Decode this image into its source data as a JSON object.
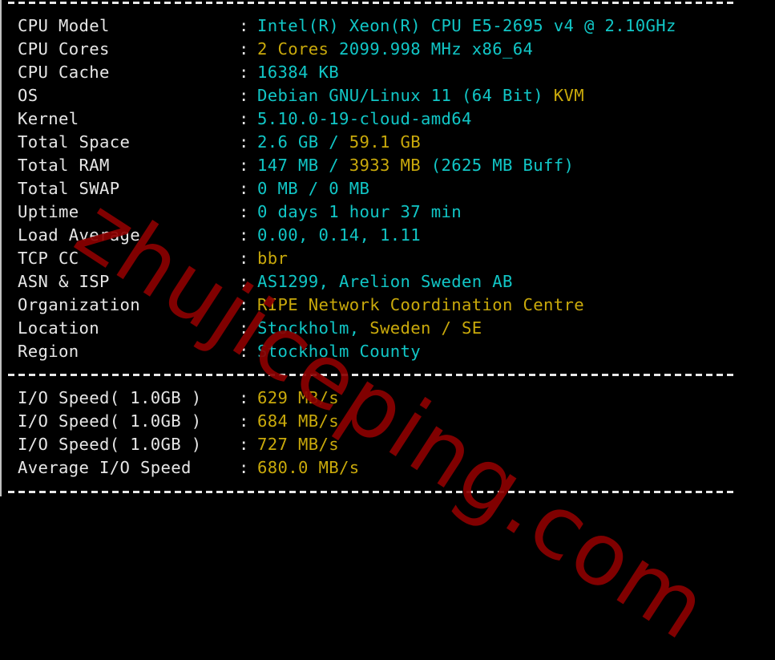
{
  "colors": {
    "background": "#000000",
    "label": "#e6e6e6",
    "cyan": "#11c6c6",
    "yellow": "#c9a90b",
    "watermark": "#8b0000"
  },
  "separator": ":",
  "system_info": [
    {
      "label": "CPU Model",
      "parts": [
        {
          "text": "Intel(R) Xeon(R) CPU E5-2695 v4 @ 2.10GHz",
          "color": "cyan"
        }
      ]
    },
    {
      "label": "CPU Cores",
      "parts": [
        {
          "text": "2 Cores",
          "color": "yellow"
        },
        {
          "text": " 2099.998 MHz x86_64",
          "color": "cyan"
        }
      ]
    },
    {
      "label": "CPU Cache",
      "parts": [
        {
          "text": "16384 KB",
          "color": "cyan"
        }
      ]
    },
    {
      "label": "OS",
      "parts": [
        {
          "text": "Debian GNU/Linux 11 (64 Bit)",
          "color": "cyan"
        },
        {
          "text": " KVM",
          "color": "yellow"
        }
      ]
    },
    {
      "label": "Kernel",
      "parts": [
        {
          "text": "5.10.0-19-cloud-amd64",
          "color": "cyan"
        }
      ]
    },
    {
      "label": "Total Space",
      "parts": [
        {
          "text": "2.6 GB / ",
          "color": "cyan"
        },
        {
          "text": "59.1 GB",
          "color": "yellow"
        }
      ]
    },
    {
      "label": "Total RAM",
      "parts": [
        {
          "text": "147 MB / ",
          "color": "cyan"
        },
        {
          "text": "3933 MB",
          "color": "yellow"
        },
        {
          "text": " (2625 MB Buff)",
          "color": "cyan"
        }
      ]
    },
    {
      "label": "Total SWAP",
      "parts": [
        {
          "text": "0 MB / 0 MB",
          "color": "cyan"
        }
      ]
    },
    {
      "label": "Uptime",
      "parts": [
        {
          "text": "0 days 1 hour 37 min",
          "color": "cyan"
        }
      ]
    },
    {
      "label": "Load Average",
      "parts": [
        {
          "text": "0.00, 0.14, 1.11",
          "color": "cyan"
        }
      ]
    },
    {
      "label": "TCP CC",
      "parts": [
        {
          "text": "bbr",
          "color": "yellow"
        }
      ]
    },
    {
      "label": "ASN & ISP",
      "parts": [
        {
          "text": "AS1299, Arelion Sweden AB",
          "color": "cyan"
        }
      ]
    },
    {
      "label": "Organization",
      "parts": [
        {
          "text": "RIPE Network Coordination Centre",
          "color": "yellow"
        }
      ]
    },
    {
      "label": "Location",
      "parts": [
        {
          "text": "Stockholm, ",
          "color": "cyan"
        },
        {
          "text": "Sweden / SE",
          "color": "yellow"
        }
      ]
    },
    {
      "label": "Region",
      "parts": [
        {
          "text": "Stockholm County",
          "color": "cyan"
        }
      ]
    }
  ],
  "io_info": [
    {
      "label": "I/O Speed( 1.0GB )",
      "parts": [
        {
          "text": "629 MB/s",
          "color": "yellow"
        }
      ]
    },
    {
      "label": "I/O Speed( 1.0GB )",
      "parts": [
        {
          "text": "684 MB/s",
          "color": "yellow"
        }
      ]
    },
    {
      "label": "I/O Speed( 1.0GB )",
      "parts": [
        {
          "text": "727 MB/s",
          "color": "yellow"
        }
      ]
    },
    {
      "label": "Average I/O Speed",
      "parts": [
        {
          "text": "680.0 MB/s",
          "color": "yellow"
        }
      ]
    }
  ],
  "watermark": "zhujiceping.com"
}
